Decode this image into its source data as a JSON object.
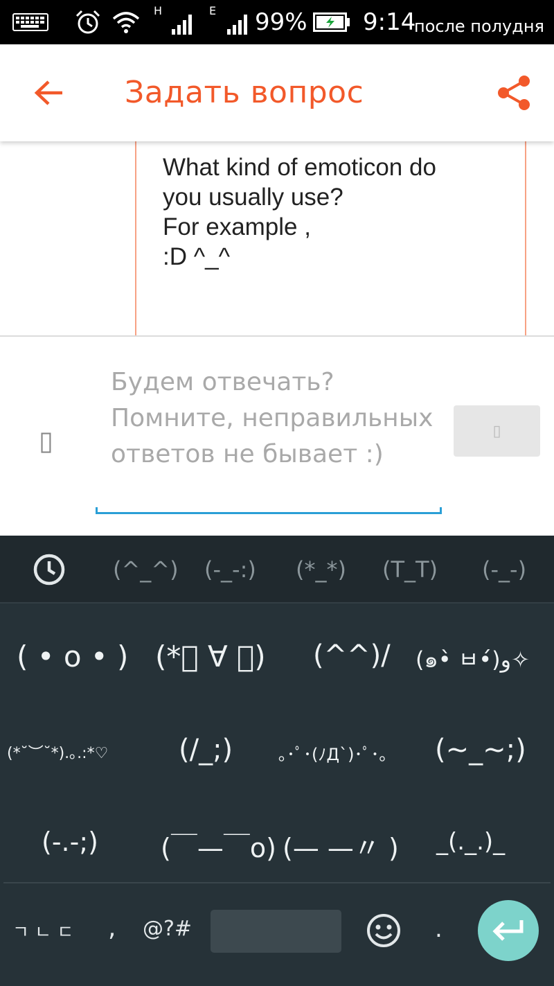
{
  "status_bar": {
    "network_1": "H",
    "network_2": "E",
    "battery_percent": "99%",
    "time": "9:14",
    "ampm": "после полудня"
  },
  "app_bar": {
    "title": "Задать вопрос",
    "back_icon": "arrow-left-icon",
    "share_icon": "share-icon",
    "accent_color": "#f2592a"
  },
  "question": {
    "text": "What kind of emoticon do\nyou usually use?\nFor example ,\n:D ^_^"
  },
  "answer": {
    "attach_glyph": "▯",
    "placeholder": "Будем отвечать? Помните, неправильных ответов не бывает :)",
    "send_glyph": "▯"
  },
  "keyboard": {
    "tabs": [
      "(^_^)",
      "(-_-:)",
      "(*_*)",
      "(T_T)",
      "(-_-)"
    ],
    "recent_icon": "clock-icon",
    "emoticons": [
      "( • o • )",
      "(*ﾟ ∀ ﾟ)",
      "(^^)/",
      "(๑•̀ ㅂ•́)و✧",
      "(*˘︶˘*).｡.:*♡",
      "(/_;)",
      "｡･ﾟ･(ﾉД`)･ﾟ･｡",
      "(~_~;)",
      "(-.-;)",
      "(￣—￣o)",
      "(— —〃 )",
      "_(._.)_"
    ],
    "bottom": {
      "hangul_key": "ㄱ ㄴ ㄷ",
      "comma_key": ",",
      "symbols_key": "@?#",
      "emoji_icon": "smiley-icon",
      "period_key": ".",
      "enter_icon": "enter-icon",
      "enter_color": "#7dd3cb"
    }
  }
}
